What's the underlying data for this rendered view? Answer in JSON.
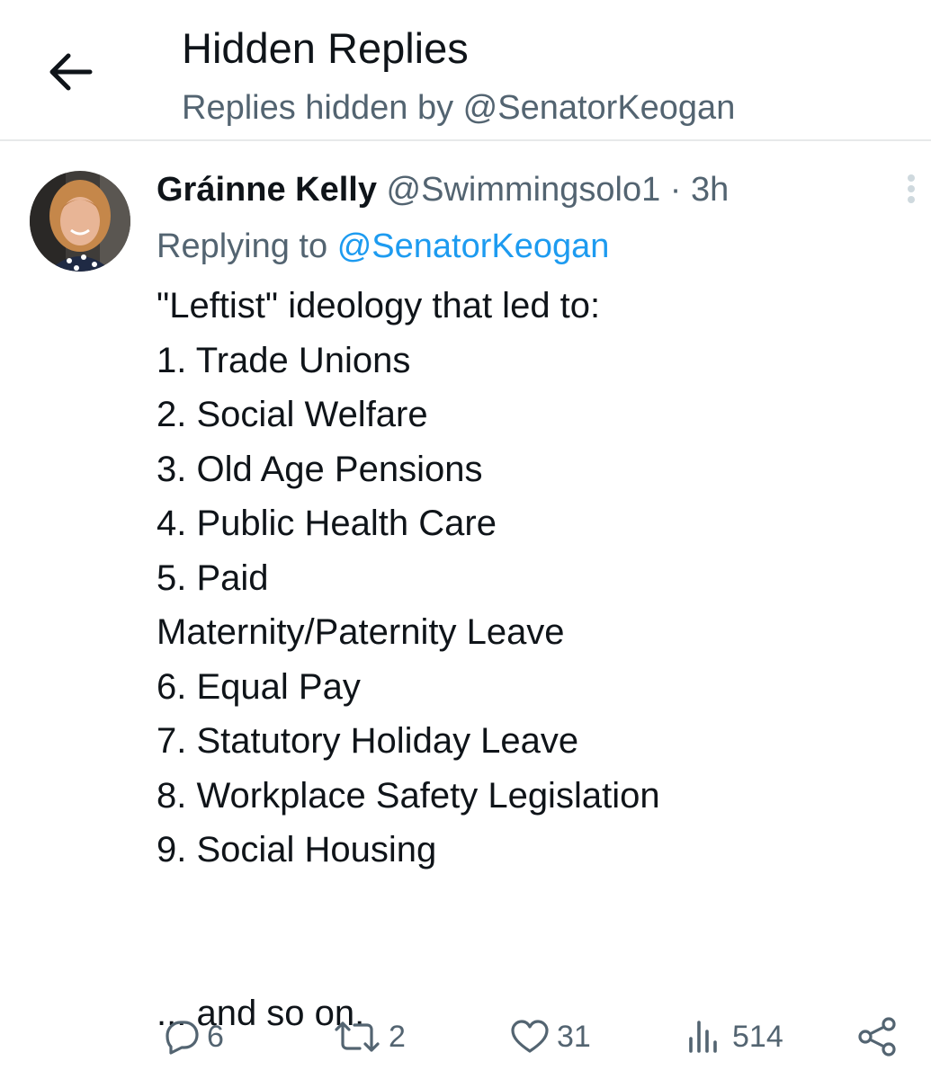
{
  "header": {
    "back_icon": "arrow-left-icon",
    "title": "Hidden Replies",
    "subtitle": "Replies hidden by @SenatorKeogan"
  },
  "tweet": {
    "author_name": "Gráinne Kelly",
    "handle": "@Swimmingsolo1",
    "separator": "·",
    "time": "3h",
    "replying_prefix": "Replying to",
    "replying_to": "@SenatorKeogan",
    "text_lines_top": [
      "\"Leftist\" ideology that led to:",
      "1. Trade Unions",
      "2. Social Welfare",
      "3. Old Age Pensions",
      "4. Public Health Care",
      "5. Paid",
      "Maternity/Paternity Leave",
      "6. Equal Pay",
      "7. Statutory Holiday Leave",
      "8. Workplace Safety Legislation",
      "9. Social Housing"
    ],
    "text_line_bottom": "... and so on.",
    "actions": {
      "reply": {
        "icon": "reply-icon",
        "count": "6"
      },
      "retweet": {
        "icon": "retweet-icon",
        "count": "2"
      },
      "like": {
        "icon": "heart-icon",
        "count": "31"
      },
      "views": {
        "icon": "views-bar-chart-icon",
        "count": "514"
      },
      "share": {
        "icon": "share-icon"
      }
    }
  },
  "colors": {
    "text_primary": "#0f1419",
    "text_secondary": "#536471",
    "link": "#1d9bf0",
    "divider": "#e7e9ea"
  }
}
